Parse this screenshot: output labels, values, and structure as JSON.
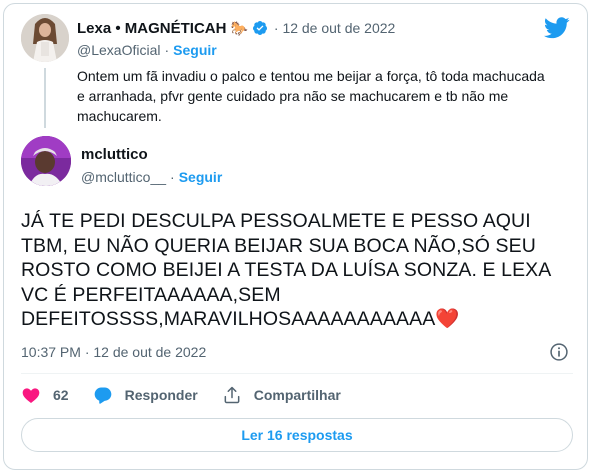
{
  "quoted": {
    "name": "Lexa • MAGNÉTICAH",
    "emoji": "🐎",
    "date_separator": "·",
    "date": "12 de out de 2022",
    "handle": "@LexaOficial",
    "separator": "·",
    "follow_label": "Seguir",
    "text": "Ontem um fã invadiu o palco e tentou me beijar a força, tô toda machucada e arranhada, pfvr gente cuidado pra não se machucarem e tb não me machucarem."
  },
  "reply": {
    "name": "mcluttico",
    "handle": "@mcluttico__",
    "separator": "·",
    "follow_label": "Seguir",
    "text": "JÁ TE PEDI DESCULPA PESSOALMETE E PESSO AQUI TBM, EU NÃO QUERIA BEIJAR SUA BOCA NÃO,SÓ SEU ROSTO COMO BEIJEI A TESTA DA LUÍSA SONZA. E LEXA VC É PERFEITAAAAAA,SEM DEFEITOSSSS,MARAVILHOSAAAAAAAAAAA",
    "text_emoji": "❤️",
    "timestamp": "10:37 PM · 12 de out de 2022"
  },
  "actions": {
    "like_count": "62",
    "reply_label": "Responder",
    "share_label": "Compartilhar"
  },
  "read_replies_label": "Ler 16 respostas",
  "icons": [
    "heart-icon",
    "reply-bubble-icon",
    "share-icon",
    "info-icon",
    "twitter-bird-icon",
    "verified-badge-icon"
  ],
  "colors": {
    "accent": "#1d9bf0",
    "like": "#f91880",
    "text_secondary": "#536471"
  }
}
